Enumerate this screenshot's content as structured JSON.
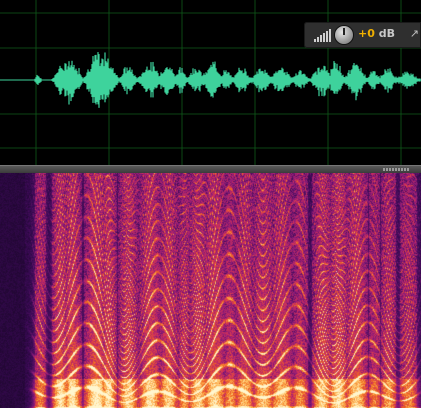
{
  "waveform": {
    "color": "#3ed39c",
    "grid_color": "#0f5a1a",
    "background": "#000000"
  },
  "hud": {
    "gain_sign": "+",
    "gain_value": "0",
    "gain_unit": "dB",
    "meter_icon": "level-meter-icon",
    "knob_icon": "volume-knob-icon",
    "pin_icon": "pin-icon"
  },
  "spectrogram": {
    "palette": [
      "#0a0413",
      "#3a0a55",
      "#8a1a7a",
      "#d0305a",
      "#f06a20",
      "#ffc060",
      "#fff6d0"
    ]
  }
}
